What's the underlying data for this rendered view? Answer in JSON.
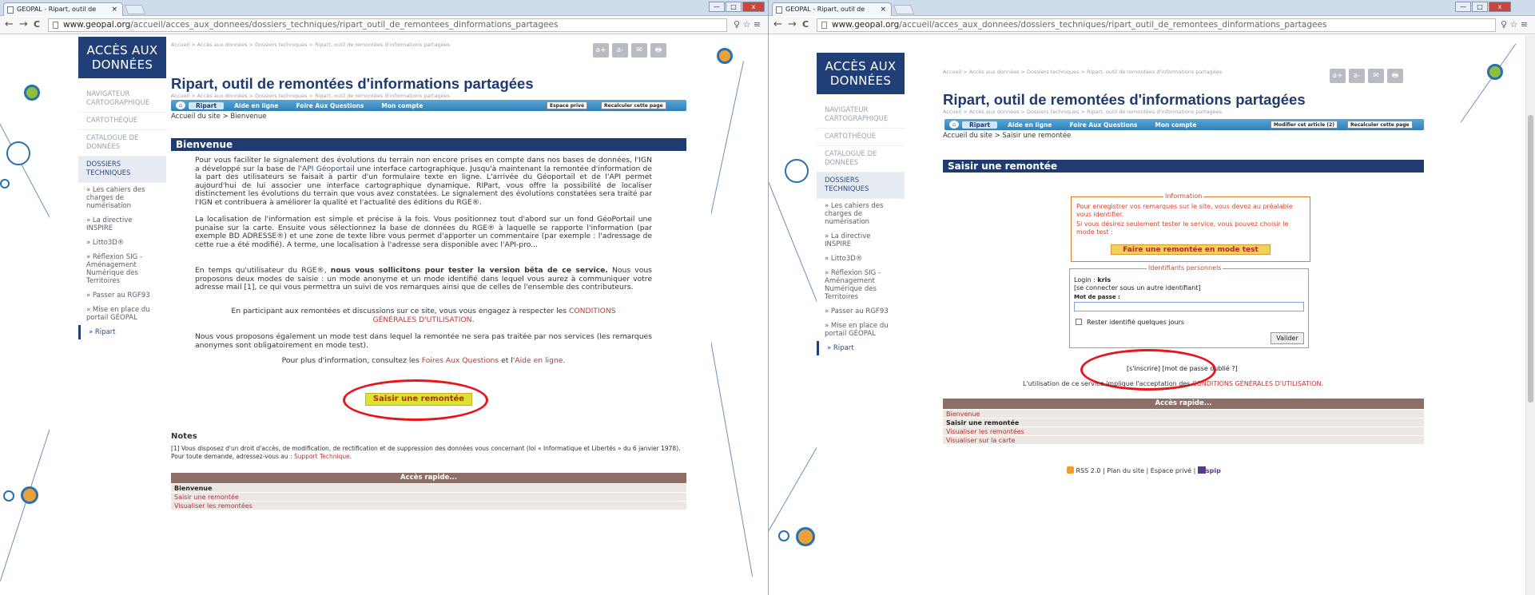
{
  "browser": {
    "tab_title": "GEOPAL - Ripart, outil de",
    "tab_close": "×",
    "url_domain": "www.geopal.org",
    "url_path": "/accueil/acces_aux_donnees/dossiers_techniques/ripart_outil_de_remontees_dinformations_partagees",
    "back": "←",
    "forward": "→",
    "reload": "C",
    "toolbar_icons": "♀ ☆ ≡",
    "minimize": "—",
    "maximize": "□",
    "close": "x"
  },
  "sidebar": {
    "head": "ACCÈS AUX DONNÉES",
    "items": [
      "NAVIGATEUR CARTOGRAPHIQUE",
      "CARTOTHÈQUE",
      "CATALOGUE DE DONNÉES",
      "DOSSIERS TECHNIQUES"
    ],
    "subitems": [
      "» Les cahiers des charges de numérisation",
      "» La directive INSPIRE",
      "» Litto3D®",
      "» Réflexion SIG - Aménagement Numérique des Territoires",
      "» Passer au RGF93",
      "» Mise en place du portail GÉOPAL",
      "» Ripart"
    ]
  },
  "main": {
    "breadcrumb_top": "Accueil > Accès aux données > Dossiers techniques > Ripart, outil de remontées d'informations partagées",
    "tool_icons": [
      "a+",
      "a-",
      "✉",
      "🖶"
    ],
    "title": "Ripart, outil de remontées d'informations partagées",
    "breadcrumb_sub": "Accueil > Accès aux données > Dossiers techniques > Ripart, outil de remontées d'informations partagées",
    "menu": [
      "Ripart",
      "Aide en ligne",
      "Foire Aux Questions",
      "Mon compte"
    ],
    "espace_prive": "Espace privé",
    "recalculer": "Recalculer cette page",
    "modifier": "Modifier cet article (2)"
  },
  "left": {
    "location": "Accueil du site > Bienvenue",
    "section": "Bienvenue",
    "p1a": "Pour vous faciliter le signalement des évolutions du terrain non encore prises en compte dans nos bases de données, l'IGN a développé sur la base de l'",
    "p1link": "API Géoportail",
    "p1b": " une interface cartographique. Jusqu'à maintenant la remontée d'information de la part des utilisateurs se faisait à partir d'un formulaire texte en ligne. L'arrivée du Géoportail et de l'API permet aujourd'hui de lui associer une interface cartographique dynamique. RIPart, vous offre la possibilité de localiser distinctement les évolutions du terrain que vous avez constatées. Le signalement des évolutions constatées sera traité par l'IGN et contribuera à améliorer la qualité et l'actualité des éditions du RGE®.",
    "p2": "La localisation de l'information est simple et précise à la fois. Vous positionnez tout d'abord sur un fond GéoPortail une punaise sur la carte. Ensuite vous sélectionnez la base de données du RGE® à laquelle se rapporte l'information (par exemple BD ADRESSE®) et une zone de texte libre vous permet d'apporter un commentaire (par exemple : l'adressage de cette rue a été modifié). A terme, une localisation à l'adresse sera disponible avec l'API-pro...",
    "p3a": "En temps qu'utilisateur du RGE®, ",
    "p3b": "nous vous sollicitons pour tester la version bêta de ce service.",
    "p3c": " Nous vous proposons deux modes de saisie : un mode anonyme et un mode identifié dans lequel vous aurez à communiquer votre adresse mail [1], ce qui vous permettra un suivi de vos remarques ainsi que de celles de l'ensemble des contributeurs.",
    "p4a": "En participant aux remontées et discussions sur ce site, vous vous engagez à respecter les ",
    "p4link": "CONDITIONS GÉNÉRALES D'UTILISATION",
    "p4b": ".",
    "p5": "Nous vous proposons également un mode test dans lequel la remontée ne sera pas traitée par nos services (les remarques anonymes sont obligatoirement en mode test).",
    "p6a": "Pour plus d'information, consultez les ",
    "p6l1": "Foires Aux Questions",
    "p6b": " et l'",
    "p6l2": "Aide en ligne",
    "p6c": ".",
    "saisir": "Saisir une remontée",
    "notes_h": "Notes",
    "notes_t": "[1] Vous disposez d'un droit d'accès, de modification, de rectification et de suppression des données vous concernant (loi « Informatique et Libertés » du 6 janvier 1978). Pour toute demande, adressez-vous au : ",
    "notes_link": "Support Technique",
    "notes_end": ".",
    "rapide_head": "Accès rapide...",
    "rapide": [
      "Bienvenue",
      "Saisir une remontée",
      "Visualiser les remontées"
    ]
  },
  "right": {
    "location": "Accueil du site > Saisir une remontée",
    "section": "Saisir une remontée",
    "info_legend": "Information",
    "info_t1": "Pour enregistrer vos remarques sur le site, vous devez au préalable vous identifier.",
    "info_t2": "Si vous désirez seulement tester le service, vous pouvez choisir le mode test :",
    "mode_test": "Faire une remontée en mode test",
    "id_legend": "Identifiants personnels",
    "login_label": "Login : ",
    "login_value": "kris",
    "other_id": "[se connecter sous un autre identifiant]",
    "password_label": "Mot de passe :",
    "remember": "Rester identifié quelques jours",
    "valider": "Valider",
    "signup_links": "[s'inscrire] [mot de passe oublié ?]",
    "cgu_a": "L'utilisation de ce service implique l'acceptation des ",
    "cgu_link": "CONDITIONS GÉNÉRALES D'UTILISATION",
    "cgu_b": ".",
    "rapide_head": "Accès rapide...",
    "rapide": [
      "Bienvenue",
      "Saisir une remontée",
      "Visualiser les remontées",
      "Visualiser sur la carte"
    ],
    "footer_a": " RSS 2.0 | Plan du site | Espace privé | ",
    "footer_spip": "spip"
  },
  "colors": {
    "navy": "#1f3b6f",
    "menu_blue": "#2f7fb8",
    "oval_red": "#e5161c",
    "brown": "#8c6f66",
    "bubble_green": "#8cbf3f",
    "bubble_orange": "#e8a23a",
    "bubble_blue": "#2a6fb0"
  }
}
